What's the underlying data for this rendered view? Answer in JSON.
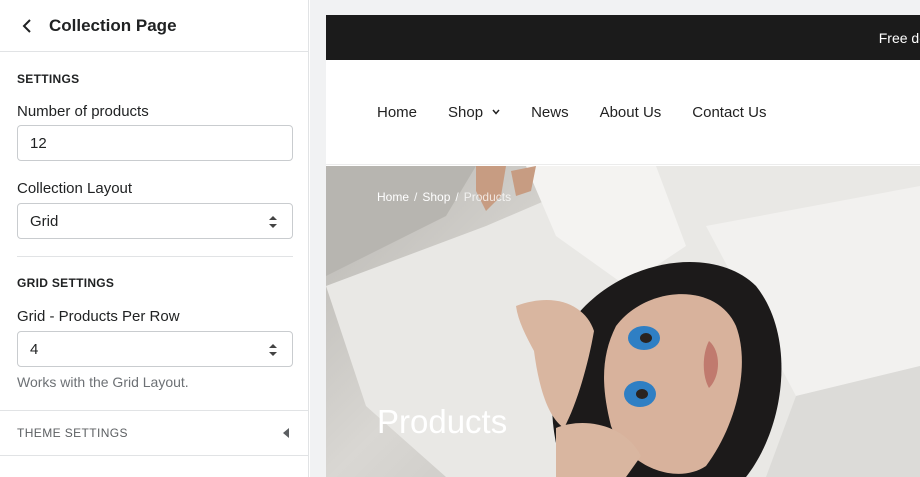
{
  "panel": {
    "title": "Collection Page",
    "settings_heading": "SETTINGS",
    "products_label": "Number of products",
    "products_value": "12",
    "layout_label": "Collection Layout",
    "layout_value": "Grid",
    "grid_heading": "GRID SETTINGS",
    "per_row_label": "Grid - Products Per Row",
    "per_row_value": "4",
    "per_row_help": "Works with the Grid Layout.",
    "theme_settings_label": "THEME SETTINGS"
  },
  "preview": {
    "announcement": "Free delive",
    "nav": [
      "Home",
      "Shop",
      "News",
      "About Us",
      "Contact Us"
    ],
    "breadcrumb": [
      "Home",
      "Shop",
      "Products"
    ],
    "hero_title": "Products"
  }
}
